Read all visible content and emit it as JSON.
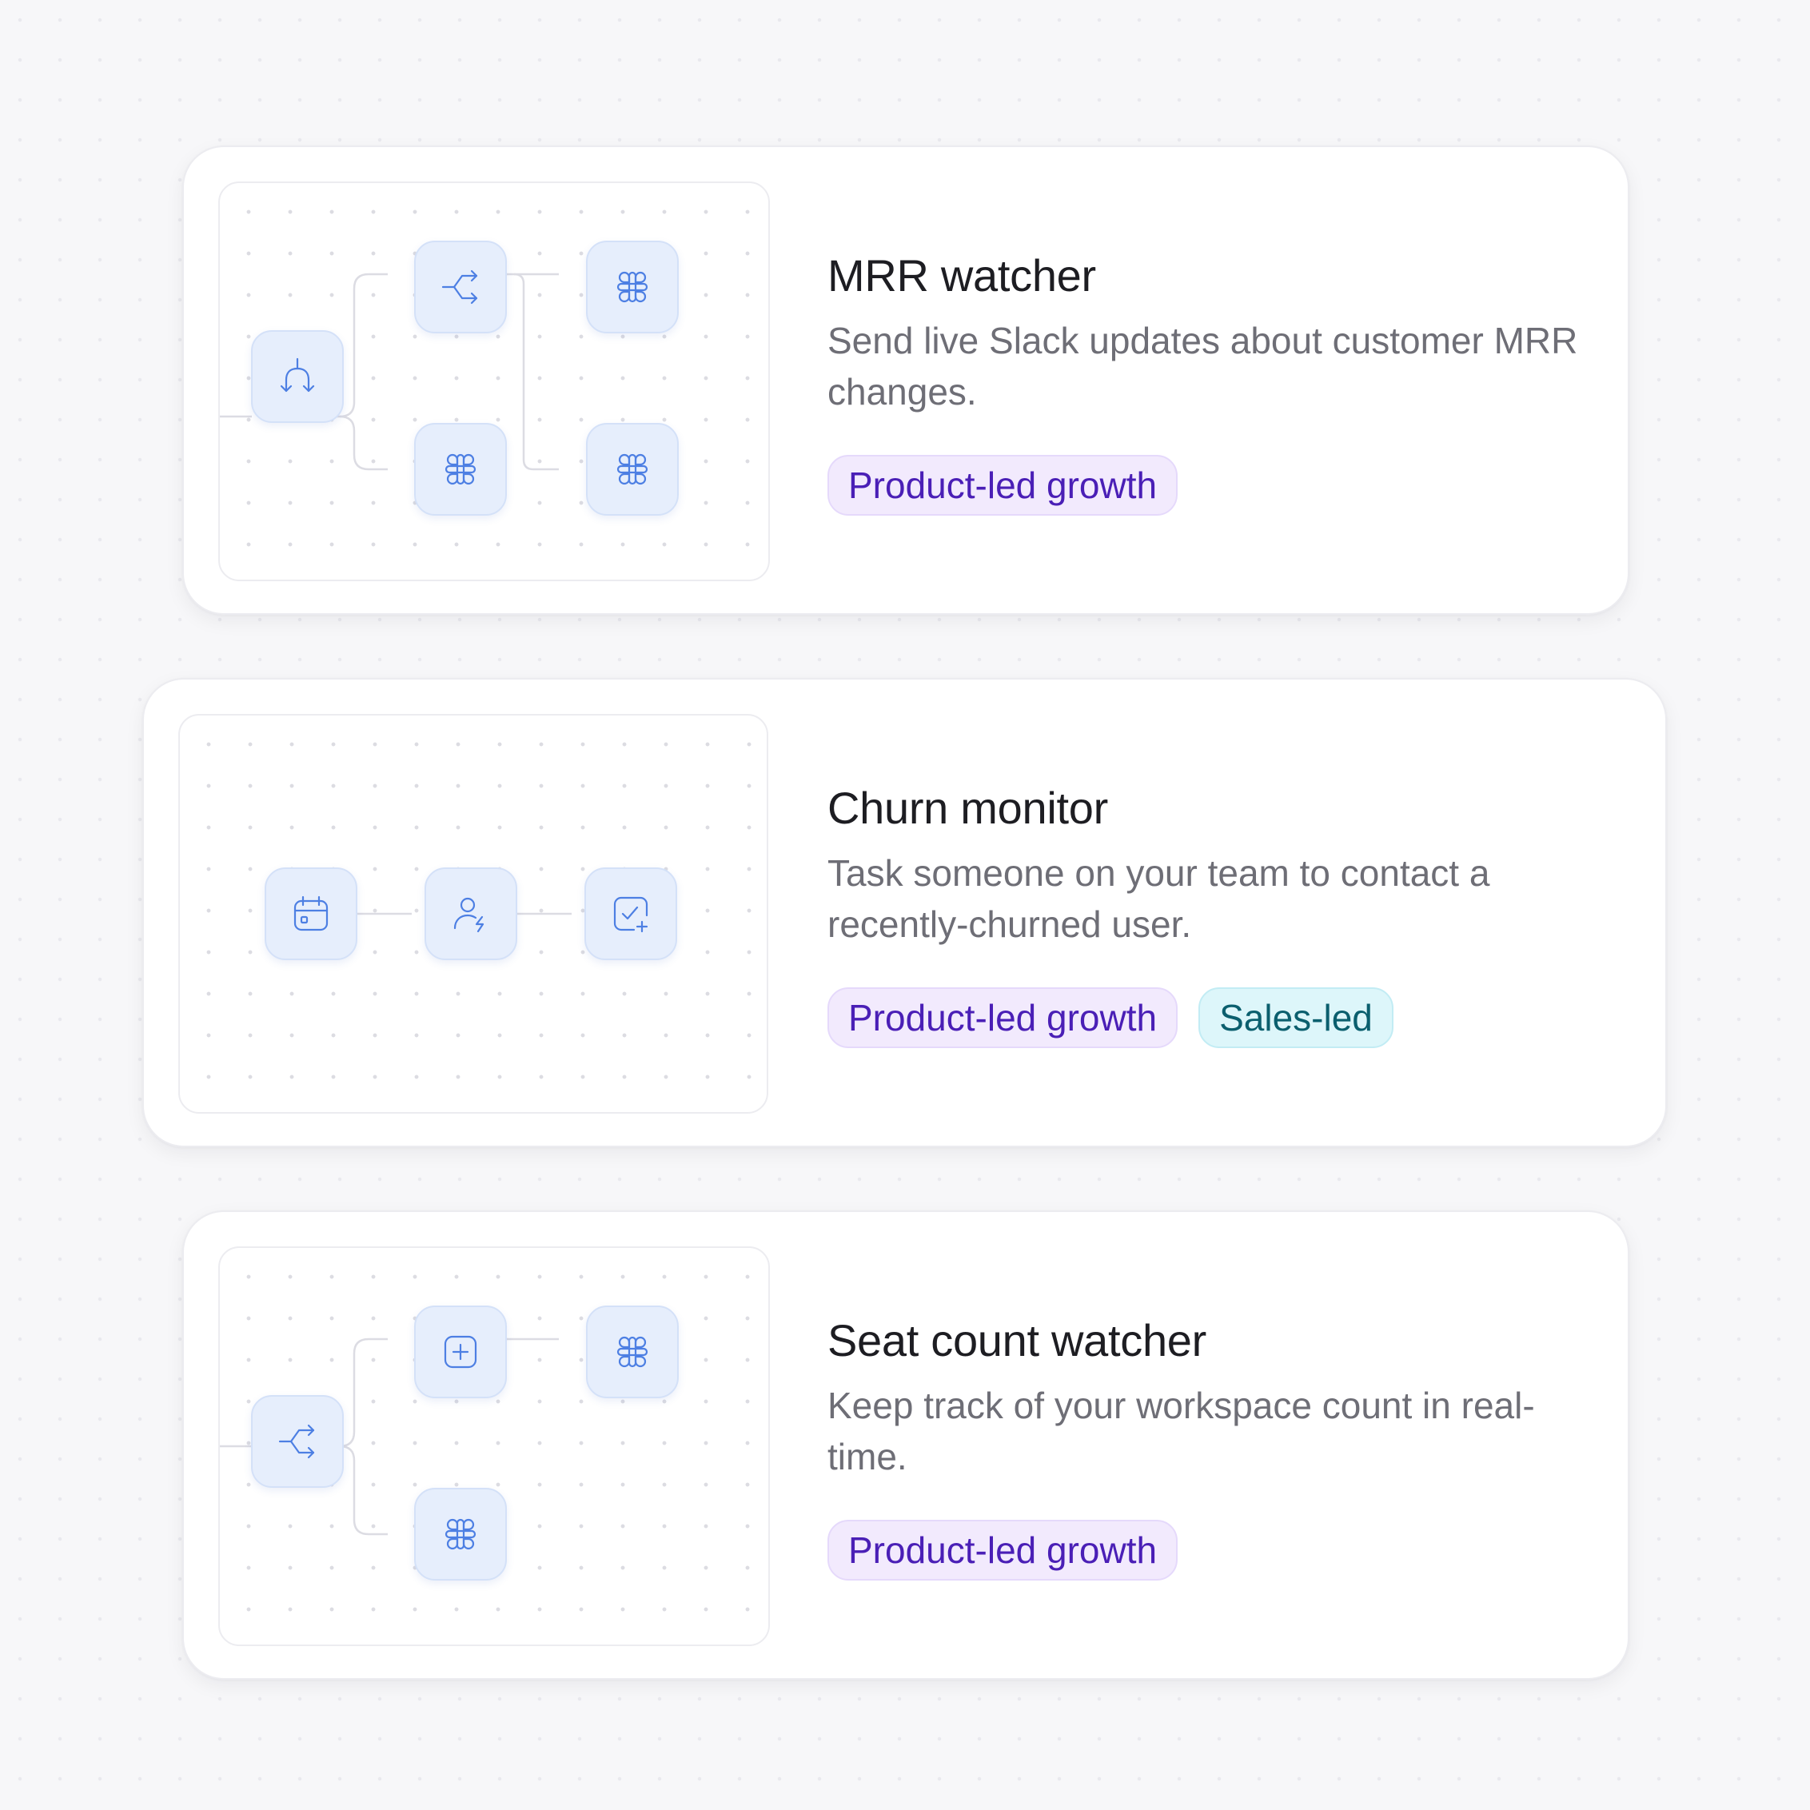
{
  "cards": [
    {
      "title": "MRR watcher",
      "description": "Send live Slack updates about customer MRR changes.",
      "tags": [
        {
          "label": "Product-led growth",
          "color": "#4a1fb6"
        }
      ],
      "nodes": [
        "split-icon",
        "route-icon",
        "slack-icon",
        "slack-icon",
        "slack-icon"
      ]
    },
    {
      "title": "Churn monitor",
      "description": "Task someone on your team to contact a recently-churned user.",
      "tags": [
        {
          "label": "Product-led growth",
          "color": "#4a1fb6"
        },
        {
          "label": "Sales-led",
          "color": "#0b5f6e"
        }
      ],
      "nodes": [
        "calendar-icon",
        "user-bolt-icon",
        "task-add-icon"
      ]
    },
    {
      "title": "Seat count watcher",
      "description": "Keep track of your workspace count in real-time.",
      "tags": [
        {
          "label": "Product-led growth",
          "color": "#4a1fb6"
        }
      ],
      "nodes": [
        "route-icon",
        "plus-square-icon",
        "slack-icon",
        "slack-icon"
      ]
    }
  ],
  "theme": {
    "node_bg": "#e6eefc",
    "icon": "#4d7fe3",
    "tag_plg_bg": "#f2eafd",
    "tag_sales_bg": "#ddf6fa"
  }
}
